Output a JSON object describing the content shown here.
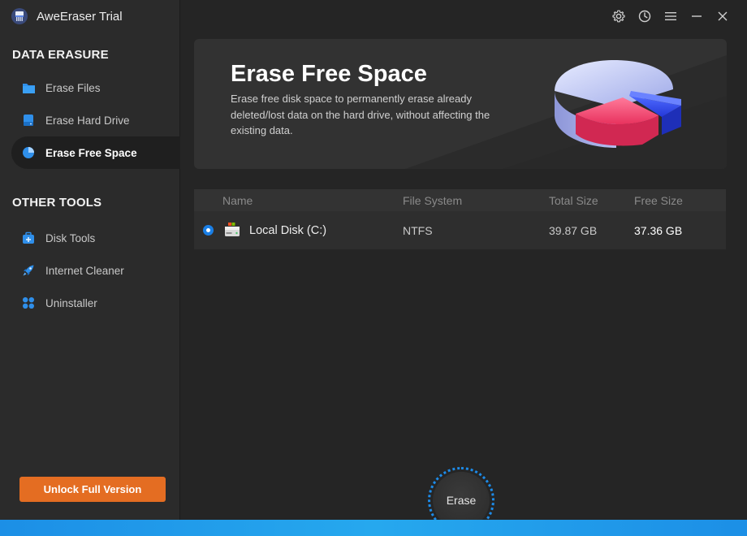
{
  "app": {
    "title": "AweEraser Trial",
    "logo_icon": "eraser-logo-icon"
  },
  "window_controls": [
    {
      "name": "settings",
      "icon": "gear-icon"
    },
    {
      "name": "history",
      "icon": "clock-icon"
    },
    {
      "name": "menu",
      "icon": "hamburger-icon"
    },
    {
      "name": "minimize",
      "icon": "minimize-icon"
    },
    {
      "name": "close",
      "icon": "close-icon"
    }
  ],
  "sidebar": {
    "section1_title": "DATA ERASURE",
    "section1_items": [
      {
        "label": "Erase Files",
        "icon": "folder-icon",
        "active": false
      },
      {
        "label": "Erase Hard Drive",
        "icon": "hard-drive-icon",
        "active": false
      },
      {
        "label": "Erase Free Space",
        "icon": "pie-chart-icon",
        "active": true
      }
    ],
    "section2_title": "OTHER TOOLS",
    "section2_items": [
      {
        "label": "Disk Tools",
        "icon": "toolbox-icon"
      },
      {
        "label": "Internet Cleaner",
        "icon": "rocket-icon"
      },
      {
        "label": "Uninstaller",
        "icon": "apps-grid-icon"
      }
    ],
    "unlock_label": "Unlock Full Version"
  },
  "banner": {
    "title": "Erase Free Space",
    "description": "Erase free disk space to permanently erase already deleted/lost data on the hard drive, without affecting the existing data.",
    "art_icon": "pie-chart-3d-illustration"
  },
  "table": {
    "columns": [
      "Name",
      "File System",
      "Total Size",
      "Free Size"
    ],
    "rows": [
      {
        "selected": true,
        "name": "Local Disk (C:)",
        "file_system": "NTFS",
        "total_size": "39.87 GB",
        "free_size": "37.36 GB",
        "icon": "local-disk-icon"
      }
    ]
  },
  "erase_label": "Erase",
  "colors": {
    "accent_blue": "#1a7fe6",
    "unlock_orange": "#e46d22",
    "sidebar_bg": "#2b2b2b",
    "main_bg": "#252525"
  }
}
